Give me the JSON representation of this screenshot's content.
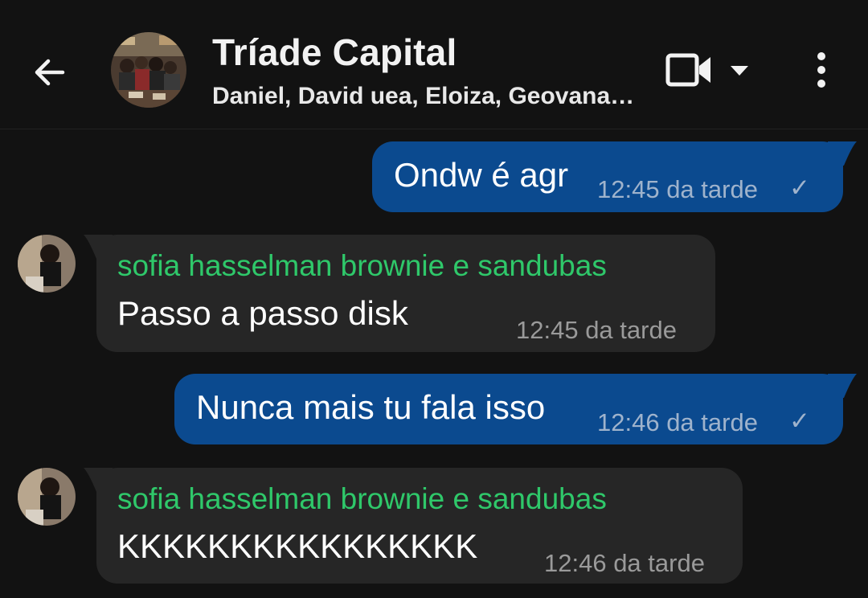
{
  "header": {
    "title": "Tríade Capital",
    "participants": "Daniel, David uea, Eloiza, Geovana…",
    "icons": {
      "back": "arrow-left-icon",
      "video": "video-camera-icon",
      "dropdown": "caret-down-icon",
      "menu": "more-vertical-icon"
    }
  },
  "messages": [
    {
      "direction": "outgoing",
      "text": "Ondw é agr",
      "time": "12:45 da tarde",
      "status": "✓"
    },
    {
      "direction": "incoming",
      "sender": "sofia hasselman brownie e sandubas",
      "text": "Passo a passo disk",
      "time": "12:45 da tarde"
    },
    {
      "direction": "outgoing",
      "text": "Nunca mais tu fala isso",
      "time": "12:46 da tarde",
      "status": "✓"
    },
    {
      "direction": "incoming",
      "sender": "sofia hasselman brownie e sandubas",
      "text": "KKKKKKKKKKKKKKKK",
      "time": "12:46 da tarde"
    }
  ],
  "colors": {
    "background": "#121212",
    "outgoing_bubble": "#0b4a8f",
    "incoming_bubble": "#262626",
    "sender_name": "#2fc86a"
  }
}
